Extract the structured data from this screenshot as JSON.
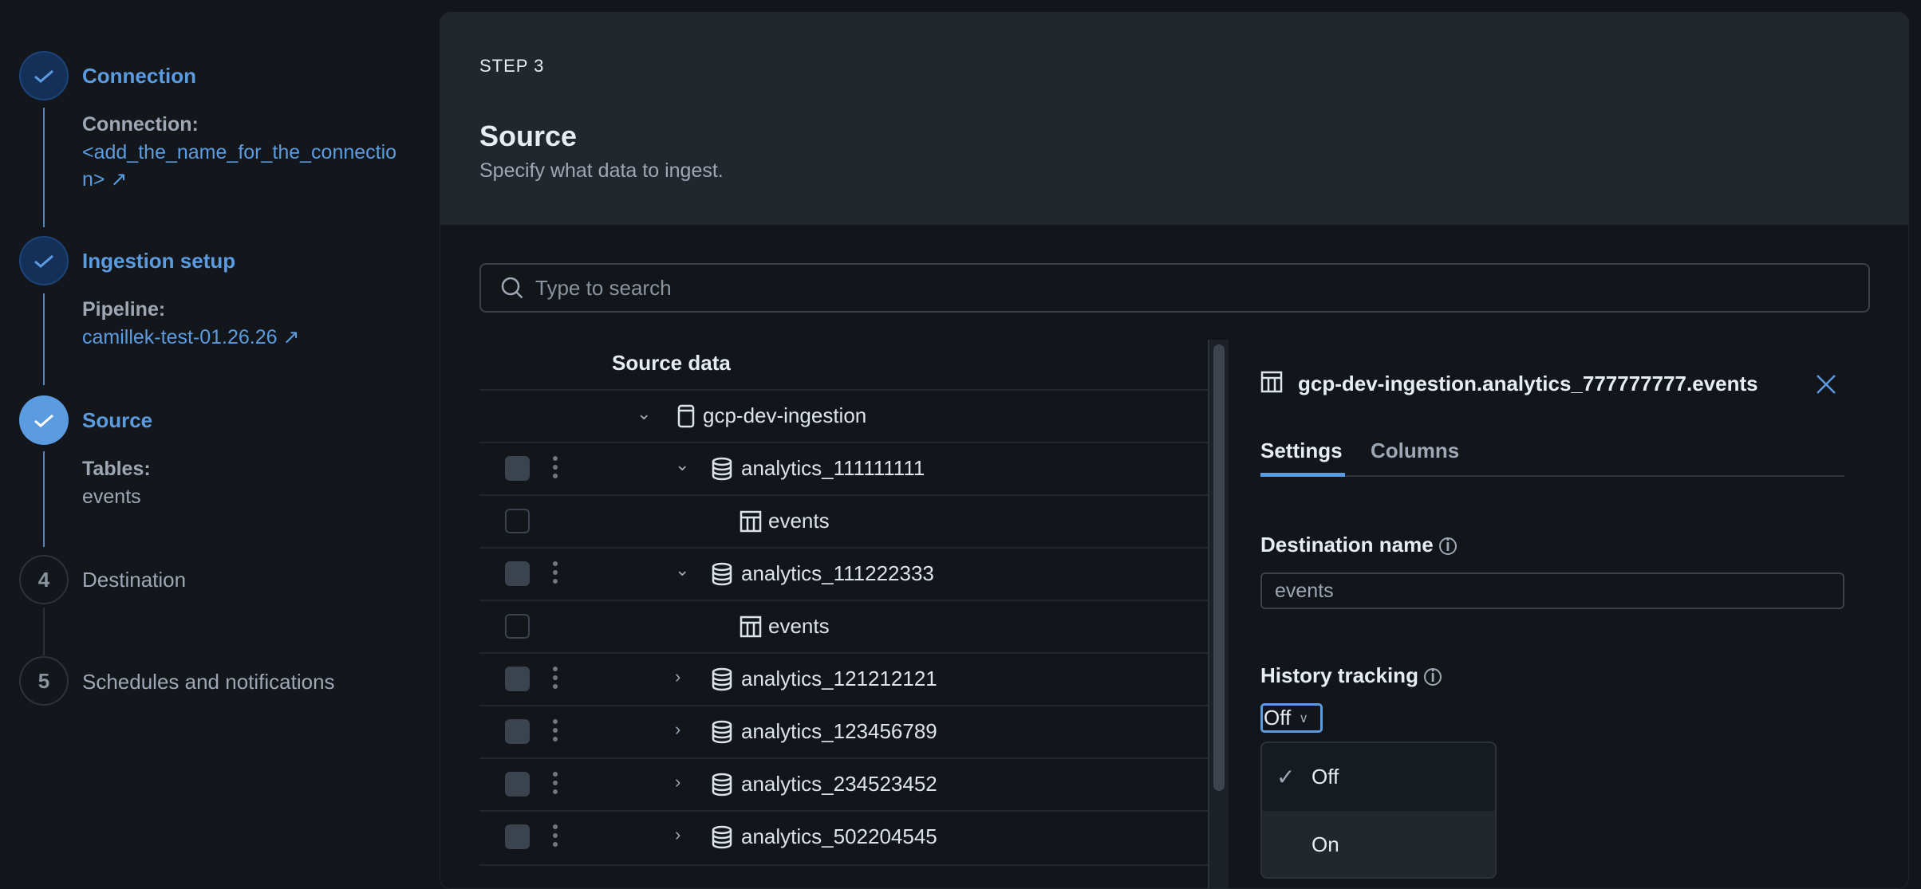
{
  "stepper": {
    "steps": [
      {
        "number": "1",
        "title": "Connection",
        "label": "Connection:",
        "value": "<add_the_name_for_the_connection>",
        "status": "done"
      },
      {
        "number": "2",
        "title": "Ingestion setup",
        "label": "Pipeline:",
        "value": "camillek-test-01.26.26",
        "status": "done"
      },
      {
        "number": "3",
        "title": "Source",
        "label": "Tables:",
        "value": "events",
        "status": "active"
      },
      {
        "number": "4",
        "title": "Destination",
        "status": "todo"
      },
      {
        "number": "5",
        "title": "Schedules and notifications",
        "status": "todo"
      }
    ]
  },
  "header": {
    "step": "STEP 3",
    "title": "Source",
    "subtitle": "Specify what data to ingest."
  },
  "search": {
    "placeholder": "Type to search"
  },
  "tree": {
    "column_header": "Source data",
    "root": "gcp-dev-ingestion",
    "rows": [
      {
        "name": "analytics_111111111",
        "type": "dataset",
        "expanded": true
      },
      {
        "name": "events",
        "type": "table"
      },
      {
        "name": "analytics_111222333",
        "type": "dataset",
        "expanded": true
      },
      {
        "name": "events",
        "type": "table"
      },
      {
        "name": "analytics_121212121",
        "type": "dataset",
        "expanded": false
      },
      {
        "name": "analytics_123456789",
        "type": "dataset",
        "expanded": false
      },
      {
        "name": "analytics_234523452",
        "type": "dataset",
        "expanded": false
      },
      {
        "name": "analytics_502204545",
        "type": "dataset",
        "expanded": false
      }
    ]
  },
  "details": {
    "title": "gcp-dev-ingestion.analytics_777777777.events",
    "tabs": [
      "Settings",
      "Columns"
    ],
    "active_tab": "Settings",
    "destination_label": "Destination name",
    "destination_value": "events",
    "history_label": "History tracking",
    "history_value": "Off",
    "history_options": [
      "Off",
      "On"
    ]
  },
  "colors": {
    "accent": "#5b9be0",
    "background": "#13171c",
    "header": "#22272e"
  }
}
